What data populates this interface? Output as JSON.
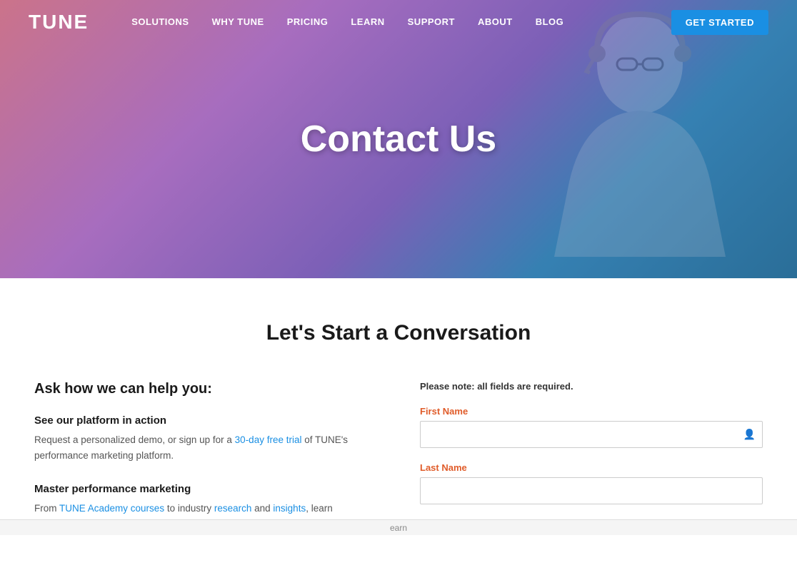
{
  "nav": {
    "logo": "TUNE",
    "links": [
      {
        "label": "SOLUTIONS",
        "href": "#"
      },
      {
        "label": "WHY TUNE",
        "href": "#"
      },
      {
        "label": "PRICING",
        "href": "#"
      },
      {
        "label": "LEARN",
        "href": "#"
      },
      {
        "label": "SUPPORT",
        "href": "#"
      },
      {
        "label": "ABOUT",
        "href": "#"
      },
      {
        "label": "BLOG",
        "href": "#"
      }
    ],
    "cta_label": "GET STARTED"
  },
  "hero": {
    "title": "Contact Us"
  },
  "main": {
    "heading": "Let's Start a Conversation",
    "left": {
      "subtitle": "Ask how we can help you:",
      "items": [
        {
          "title": "See our platform in action",
          "text_before": "Request a personalized demo, or sign up for a ",
          "link_text": "30-day free trial",
          "text_after": " of TUNE's performance marketing platform."
        },
        {
          "title": "Master performance marketing",
          "text_before": "From ",
          "link1_text": "TUNE Academy courses",
          "text_middle": " to industry ",
          "link2_text": "research",
          "text_and": " and ",
          "link3_text": "insights",
          "text_after": ", learn"
        }
      ]
    },
    "form": {
      "required_note": "Please note: all fields are required.",
      "first_name_label": "First Name",
      "last_name_label": "Last Name"
    }
  },
  "footer": {
    "learn_text": "earn"
  }
}
